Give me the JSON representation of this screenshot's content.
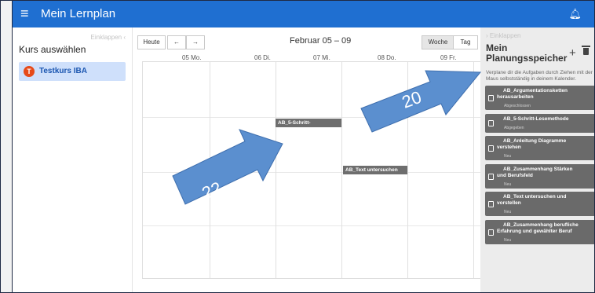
{
  "app": {
    "title": "Mein Lernplan",
    "menu_icon": "menu-icon",
    "bell_icon": "bell-icon"
  },
  "courses": {
    "collapse_label": "Einklappen",
    "heading": "Kurs auswählen",
    "items": [
      {
        "initial": "T",
        "label": "Testkurs IBA"
      }
    ]
  },
  "calendar": {
    "today_label": "Heute",
    "prev_label": "←",
    "next_label": "→",
    "range": "Februar 05 – 09",
    "view_week": "Woche",
    "view_day": "Tag",
    "days": [
      "05 Mo.",
      "06 Di.",
      "07 Mi.",
      "08 Do.",
      "09 Fr."
    ],
    "events": [
      "AB_5-Schritt-",
      "AB_Text untersuchen"
    ]
  },
  "planner": {
    "collapse_label": "Einklappen",
    "title": "Mein Planungsspeicher",
    "description": "Verplane dir die Aufgaben durch Ziehen mit der Maus selbstständig in deinem Kalender.",
    "tasks": [
      {
        "name_1": "AB_Argumentationsketten",
        "name_2": "herausarbeiten",
        "status": "Abgeschlossen"
      },
      {
        "name_1": "AB_5-Schritt-Lesemethode",
        "name_2": "",
        "status": "Abgegeben"
      },
      {
        "name_1": "AB_Anleitung Diagramme",
        "name_2": "verstehen",
        "status": "Neu"
      },
      {
        "name_1": "AB_Zusammenhang Stärken",
        "name_2": "und Berufsfeld",
        "status": "Neu"
      },
      {
        "name_1": "AB_Text untersuchen und",
        "name_2": "vorstellen",
        "status": "Neu"
      },
      {
        "name_1": "AB_Zusammenhang berufliche",
        "name_2": "Erfahrung und gewählter Beruf",
        "status": "Neu"
      }
    ]
  },
  "annotations": {
    "arrow_1": "22",
    "arrow_2": "20"
  },
  "colors": {
    "topbar": "#1f6fd1",
    "course_highlight": "#cfe0fb",
    "badge": "#e64a19",
    "task": "#6a6a6a",
    "arrow": "#5b8fcf"
  }
}
